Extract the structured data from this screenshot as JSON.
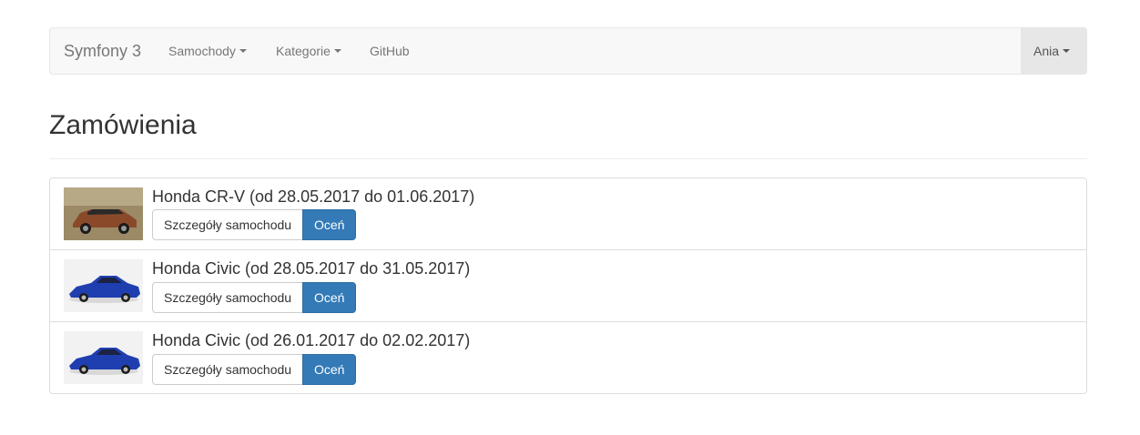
{
  "navbar": {
    "brand": "Symfony 3",
    "items": [
      {
        "label": "Samochody",
        "dropdown": true
      },
      {
        "label": "Kategorie",
        "dropdown": true
      },
      {
        "label": "GitHub",
        "dropdown": false
      }
    ],
    "user": {
      "label": "Ania",
      "dropdown": true
    }
  },
  "page": {
    "title": "Zamówienia"
  },
  "orders": [
    {
      "title": "Honda CR-V (od 28.05.2017 do 01.06.2017)",
      "details_label": "Szczegóły samochodu",
      "rate_label": "Oceń",
      "car_color": "#8a4a2a"
    },
    {
      "title": "Honda Civic (od 28.05.2017 do 31.05.2017)",
      "details_label": "Szczegóły samochodu",
      "rate_label": "Oceń",
      "car_color": "#1f3fb0"
    },
    {
      "title": "Honda Civic (od 26.01.2017 do 02.02.2017)",
      "details_label": "Szczegóły samochodu",
      "rate_label": "Oceń",
      "car_color": "#1f3fb0"
    }
  ],
  "colors": {
    "primary": "#337ab7",
    "navbar_bg": "#f8f8f8",
    "border": "#dddddd"
  }
}
